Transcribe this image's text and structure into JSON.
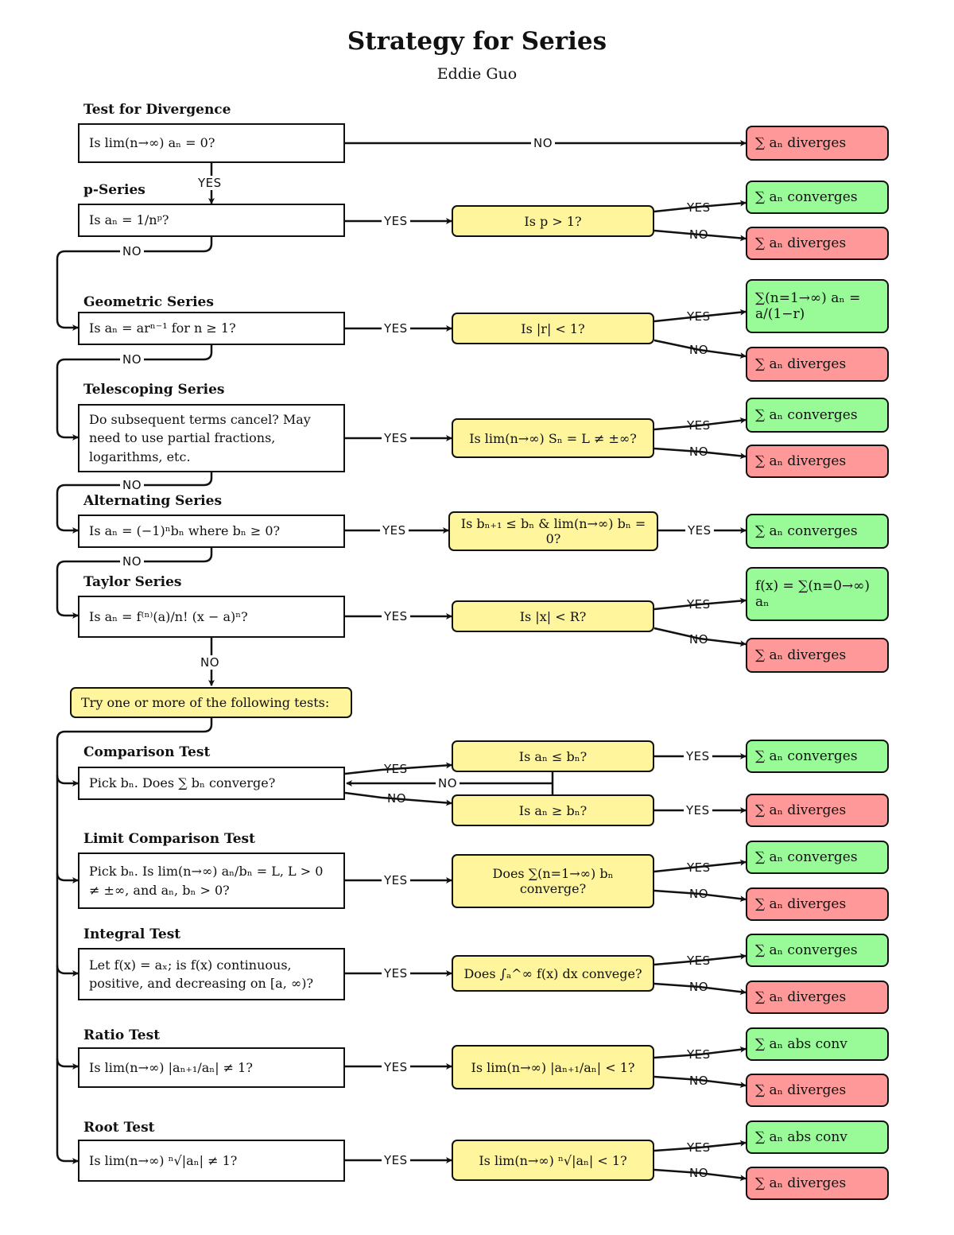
{
  "header": {
    "title": "Strategy for Series",
    "author": "Eddie Guo"
  },
  "colors": {
    "question": "#fff59d",
    "converges": "#98fb98",
    "diverges": "#ff9999",
    "line": "#111111"
  },
  "labels": {
    "yes": "YES",
    "no": "NO"
  },
  "sections": {
    "divergence": {
      "title": "Test for Divergence",
      "question": "Is lim(n→∞) aₙ = 0?",
      "result_no": "∑ aₙ diverges"
    },
    "p_series": {
      "title": "p-Series",
      "question": "Is aₙ = 1/nᵖ?",
      "check": "Is p > 1?",
      "result_yes": "∑ aₙ converges",
      "result_no": "∑ aₙ diverges"
    },
    "geometric": {
      "title": "Geometric Series",
      "question": "Is aₙ = arⁿ⁻¹ for n ≥ 1?",
      "check": "Is |r| < 1?",
      "result_yes": "∑(n=1→∞) aₙ = a/(1−r)",
      "result_no": "∑ aₙ diverges"
    },
    "telescoping": {
      "title": "Telescoping Series",
      "question": "Do subsequent terms cancel? May need to use partial fractions, logarithms, etc.",
      "check": "Is lim(n→∞) Sₙ = L ≠ ±∞?",
      "result_yes": "∑ aₙ converges",
      "result_no": "∑ aₙ diverges"
    },
    "alternating": {
      "title": "Alternating Series",
      "question": "Is aₙ = (−1)ⁿbₙ where bₙ ≥ 0?",
      "check": "Is bₙ₊₁ ≤ bₙ & lim(n→∞) bₙ = 0?",
      "result_yes": "∑ aₙ converges"
    },
    "taylor": {
      "title": "Taylor Series",
      "question": "Is aₙ = f⁽ⁿ⁾(a)/n! (x − a)ⁿ?",
      "check": "Is |x| < R?",
      "result_yes": "f(x) = ∑(n=0→∞) aₙ",
      "result_no": "∑ aₙ diverges"
    },
    "try_more": {
      "text": "Try one or more of the following tests:"
    },
    "comparison": {
      "title": "Comparison Test",
      "question": "Pick bₙ. Does ∑ bₙ converge?",
      "check_le": "Is aₙ ≤ bₙ?",
      "check_ge": "Is aₙ ≥ bₙ?",
      "result_yes": "∑ aₙ converges",
      "result_no": "∑ aₙ diverges"
    },
    "limit_comparison": {
      "title": "Limit Comparison Test",
      "question": "Pick bₙ. Is lim(n→∞) aₙ/bₙ = L, L > 0 ≠ ±∞, and aₙ, bₙ > 0?",
      "check": "Does ∑(n=1→∞) bₙ converge?",
      "result_yes": "∑ aₙ converges",
      "result_no": "∑ aₙ diverges"
    },
    "integral": {
      "title": "Integral Test",
      "question": "Let f(x) = aₓ; is f(x) continuous, positive, and decreasing on [a, ∞)?",
      "check": "Does ∫ₐ^∞ f(x) dx convege?",
      "result_yes": "∑ aₙ converges",
      "result_no": "∑ aₙ diverges"
    },
    "ratio": {
      "title": "Ratio Test",
      "question": "Is lim(n→∞) |aₙ₊₁/aₙ| ≠ 1?",
      "check": "Is lim(n→∞) |aₙ₊₁/aₙ| < 1?",
      "result_yes": "∑ aₙ abs conv",
      "result_no": "∑ aₙ diverges"
    },
    "root": {
      "title": "Root Test",
      "question": "Is lim(n→∞) ⁿ√|aₙ| ≠ 1?",
      "check": "Is lim(n→∞) ⁿ√|aₙ| < 1?",
      "result_yes": "∑ aₙ abs conv",
      "result_no": "∑ aₙ diverges"
    }
  }
}
